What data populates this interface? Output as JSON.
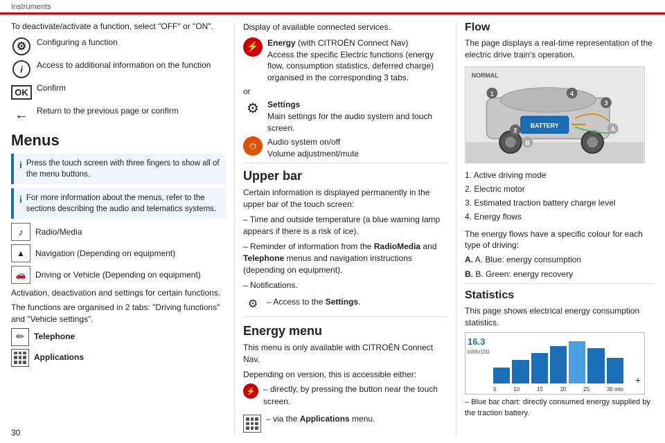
{
  "header": {
    "title": "Instruments",
    "red_line": true
  },
  "page_number": "30",
  "left_col": {
    "intro": "To deactivate/activate a function, select \"OFF\" or \"ON\".",
    "icon_rows": [
      {
        "icon_type": "gear",
        "text": "Configuring a function"
      },
      {
        "icon_type": "info",
        "text": "Access to additional information on the function"
      },
      {
        "icon_type": "ok",
        "text": "Confirm"
      },
      {
        "icon_type": "arrow",
        "text": "Return to the previous page or confirm"
      }
    ],
    "menus_title": "Menus",
    "info_boxes": [
      {
        "text": "Press the touch screen with three fingers to show all of the menu buttons."
      },
      {
        "text": "For more information about the menus, refer to the sections describing the audio and telematics systems."
      }
    ],
    "menu_items": [
      {
        "icon_type": "music",
        "label": "Radio/Media"
      },
      {
        "icon_type": "nav",
        "label": "Navigation (Depending on equipment)"
      },
      {
        "icon_type": "car",
        "label": "Driving or Vehicle (Depending on equipment)"
      }
    ],
    "activation_text": "Activation, deactivation and settings for certain functions.",
    "tabs_text": "The functions are organised in 2 tabs: \"Driving functions\" and \"Vehicle settings\".",
    "phone_apps": [
      {
        "icon_type": "pencil",
        "label": "Telephone"
      },
      {
        "icon_type": "grid",
        "label": "Applications"
      }
    ]
  },
  "mid_col": {
    "connected_text": "Display of available connected services.",
    "energy_row": {
      "label": "Energy",
      "sublabel": "(with CITROËN Connect Nav)",
      "desc": "Access the specific Electric functions (energy flow, consumption statistics, deferred charge) organised in the corresponding 3 tabs."
    },
    "or_text": "or",
    "settings_row": {
      "label": "Settings",
      "desc": "Main settings for the audio system and touch screen."
    },
    "audio_row": {
      "label1": "Audio system on/off",
      "label2": "Volume adjustment/mute"
    },
    "upper_bar_title": "Upper bar",
    "upper_bar_desc": "Certain information is displayed permanently in the upper bar of the touch screen:",
    "upper_bar_items": [
      "– Time and outside temperature (a blue warning lamp appears if there is a risk of ice).",
      "– Reminder of information from the RadioMedia and Telephone menus and navigation instructions (depending on equipment).",
      "– Notifications."
    ],
    "settings_access": "– Access to the Settings.",
    "energy_menu_title": "Energy menu",
    "energy_menu_text": "This menu is only available with CITROËN Connect Nav.",
    "energy_menu_access": "Depending on version, this is accessible either:",
    "energy_menu_items": [
      "– directly, by pressing the button near the touch screen.",
      "– via the Applications menu."
    ]
  },
  "right_col": {
    "flow_title": "Flow",
    "flow_desc": "The page displays a real-time representation of the electric drive train's operation.",
    "diagram_label": "NORMAL",
    "diagram_numbers": [
      "1",
      "2",
      "3",
      "4"
    ],
    "diagram_letters": [
      "A",
      "B"
    ],
    "flow_list_title": "",
    "flow_list": [
      "1. Active driving mode",
      "2. Electric motor",
      "3. Estimated traction battery charge level",
      "4. Energy flows"
    ],
    "flow_colour_text": "The energy flows have a specific colour for each type of driving:",
    "flow_colours": [
      "A. Blue: energy consumption",
      "B. Green: energy recovery"
    ],
    "stats_title": "Statistics",
    "stats_desc": "This page shows electrical energy consumption statistics.",
    "chart": {
      "y_value": "16.3",
      "y_unit1": "kWh/100",
      "y_unit2": "kWh/100",
      "bars": [
        30,
        45,
        55,
        70,
        80,
        65,
        50
      ],
      "x_labels": [
        "5",
        "10",
        "15",
        "20",
        "25",
        "30 min"
      ]
    },
    "blue_bar_text": "– Blue bar chart: directly consumed energy supplied by the traction battery."
  }
}
